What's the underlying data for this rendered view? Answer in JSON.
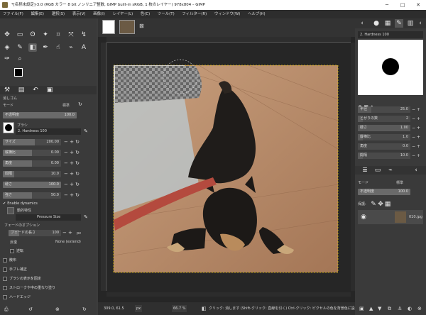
{
  "window": {
    "title": "*[名称未設定]-3.0 (RGB カラー 8 bit ノンリニア整数, GIMP built-in sRGB, 1 枚のレイヤー) 978x804 – GIMP"
  },
  "menu": [
    "ファイル(F)",
    "編集(E)",
    "選択(S)",
    "表示(V)",
    "画像(I)",
    "レイヤー(L)",
    "色(C)",
    "ツール(T)",
    "フィルター(R)",
    "ウィンドウ(W)",
    "ヘルプ(H)"
  ],
  "tool_options": {
    "title": "消しゴム",
    "mode_label": "モード",
    "mode_value": "標準",
    "opacity_label": "不透明度",
    "opacity_value": "100.0",
    "brush_label": "ブラシ",
    "brush_name": "2. Hardness 100",
    "sliders": [
      {
        "label": "サイズ",
        "value": "200.00",
        "fraction": 0.55
      },
      {
        "label": "縦横比",
        "value": "0.00",
        "fraction": 0.5
      },
      {
        "label": "角度",
        "value": "0.00",
        "fraction": 0.5
      },
      {
        "label": "間隔",
        "value": "10.0",
        "fraction": 0.2
      },
      {
        "label": "硬さ",
        "value": "100.0",
        "fraction": 1.0
      },
      {
        "label": "強さ",
        "value": "50.0",
        "fraction": 0.5
      }
    ],
    "enable_dynamics": "Enable dynamics",
    "dynamics_label": "動的特性",
    "dynamics_value": "Pressure Size",
    "fade_options": "フェードのオプション",
    "fade_length_label": "フェードの長さ",
    "fade_length_value": "100",
    "fade_unit": "px",
    "repeat_label": "反復",
    "repeat_value": "None (extend)",
    "reverse": "逆転",
    "scatter": "散布",
    "smooth": "手ブレ補正",
    "lock_brush": "ブラシの表示を固定",
    "stroke_overlap": "ストロークや中の重なり塗り",
    "hard_edge": "ハードエッジ"
  },
  "status": {
    "coords": "309.0, 61.5",
    "unit": "px",
    "zoom": "66.7 %",
    "message": "クリック: 消します (Shift-クリック: 直線を引く) Ctrl-クリック: ピクセルの色を背景色に設定"
  },
  "brush_panel": {
    "brush_name": "2. Hardness 100",
    "rows": [
      {
        "label": "半径",
        "value": "25.0",
        "fraction": 0.25
      },
      {
        "label": "とがりの数",
        "value": "2",
        "fraction": 0.1
      },
      {
        "label": "硬さ",
        "value": "1.00",
        "fraction": 1.0
      },
      {
        "label": "縦横比",
        "value": "1.0",
        "fraction": 0.1
      },
      {
        "label": "角度",
        "value": "0.0",
        "fraction": 0.0
      },
      {
        "label": "間隔",
        "value": "10.0",
        "fraction": 0.1
      }
    ]
  },
  "layers": {
    "mode_label": "モード",
    "mode_value": "標準",
    "opacity_label": "不透明度",
    "opacity_value": "100.0",
    "lock_label": "保護:",
    "layer_name": "010.jpg"
  },
  "colors": {
    "accent": "#e8a23d",
    "fg": "#000000",
    "bg": "#ffffff"
  }
}
